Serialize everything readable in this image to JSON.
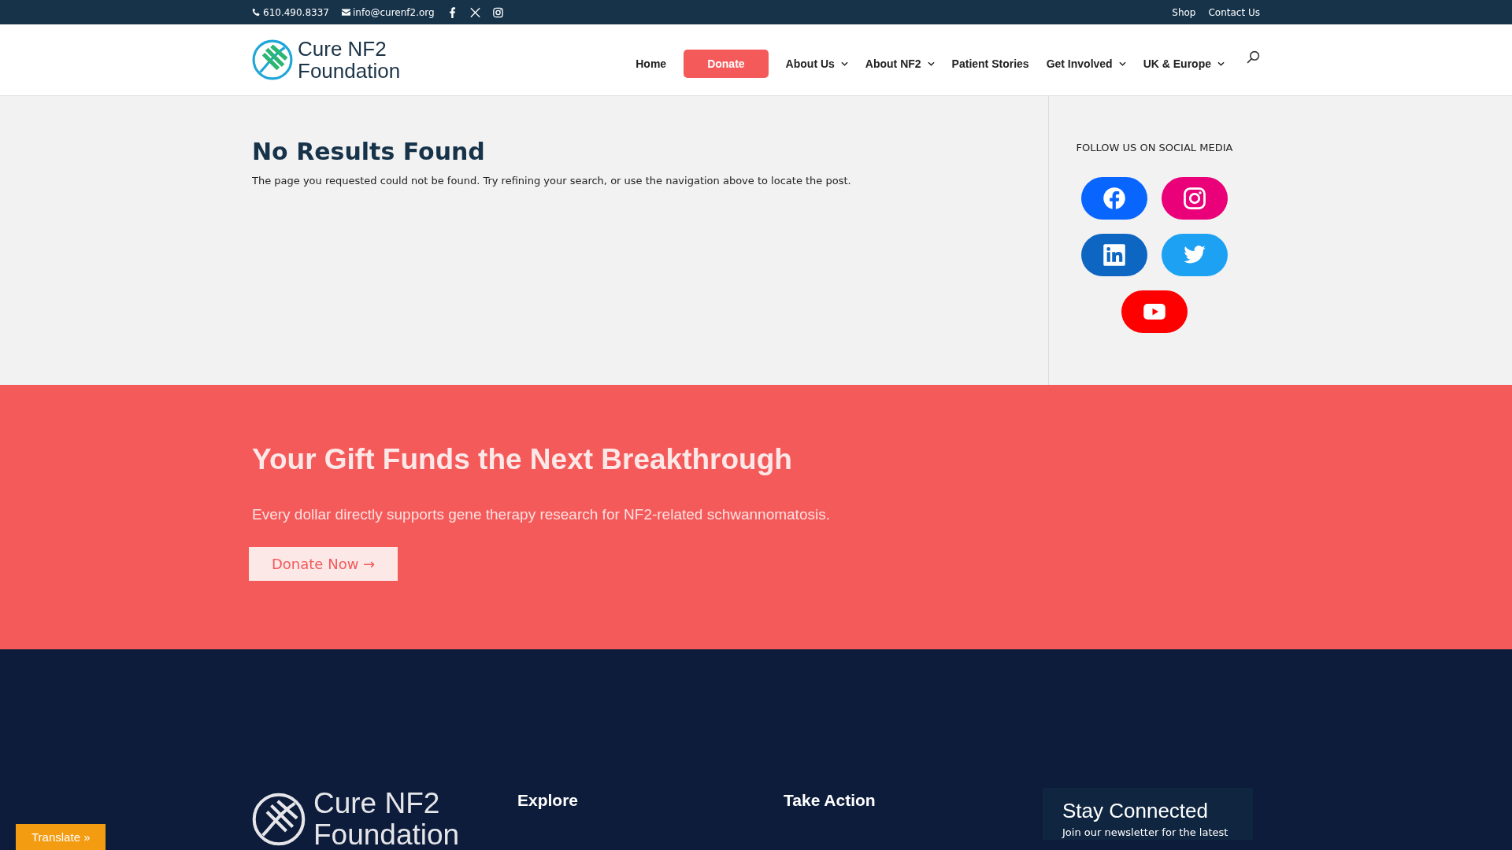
{
  "top_bar": {
    "phone": "610.490.8337",
    "email": "info@curenf2.org",
    "links": [
      "Shop",
      "Contact Us"
    ]
  },
  "header": {
    "logo": [
      "Cure NF2",
      "Foundation"
    ],
    "nav": [
      {
        "label": "Home",
        "kind": "link",
        "dropdown": false
      },
      {
        "label": "Donate",
        "kind": "button",
        "dropdown": false
      },
      {
        "label": "About Us",
        "kind": "link",
        "dropdown": true
      },
      {
        "label": "About NF2",
        "kind": "link",
        "dropdown": true
      },
      {
        "label": "Patient Stories",
        "kind": "link",
        "dropdown": false
      },
      {
        "label": "Get Involved",
        "kind": "link",
        "dropdown": true
      },
      {
        "label": "UK & Europe",
        "kind": "link",
        "dropdown": true
      }
    ]
  },
  "main": {
    "title": "No Results Found",
    "message": "The page you requested could not be found. Try refining your search, or use the navigation above to locate the post."
  },
  "sidebar": {
    "title": "FOLLOW US ON SOCIAL MEDIA",
    "social": [
      {
        "kind": "facebook",
        "color": "#0866ff"
      },
      {
        "kind": "instagram",
        "color": "#ea0079"
      },
      {
        "kind": "linkedin",
        "color": "#0c66c2"
      },
      {
        "kind": "twitter",
        "color": "#1da1f2"
      },
      {
        "kind": "youtube",
        "color": "#ff0000"
      }
    ]
  },
  "cta": {
    "heading": "Your Gift Funds the Next Breakthrough",
    "text": "Every dollar directly supports gene therapy research for NF2-related schwannomatosis.",
    "button": "Donate Now →"
  },
  "footer": {
    "logo": [
      "Cure NF2",
      "Foundation"
    ],
    "columns": [
      "Explore",
      "Take Action"
    ],
    "newsletter": {
      "title": "Stay Connected",
      "text": "Join our newsletter for the latest"
    }
  },
  "translate": "Translate »"
}
